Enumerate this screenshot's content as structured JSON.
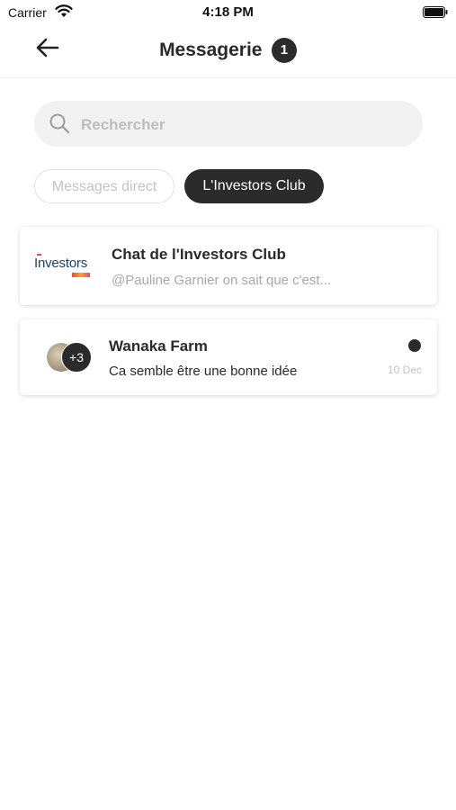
{
  "status_bar": {
    "carrier": "Carrier",
    "time": "4:18 PM"
  },
  "header": {
    "title": "Messagerie",
    "badge_count": "1",
    "back_icon": "arrow-left-icon"
  },
  "search": {
    "placeholder": "Rechercher",
    "value": "",
    "icon": "search-icon"
  },
  "tabs": [
    {
      "label": "Messages direct",
      "active": false
    },
    {
      "label": "L'Investors Club",
      "active": true
    }
  ],
  "conversations": [
    {
      "logo_text": "Investors",
      "name": "Chat de l'Investors Club",
      "preview": "@Pauline Garnier on sait que c'est...",
      "date": "",
      "unread": false
    },
    {
      "avatar_more": "+3",
      "name": "Wanaka Farm",
      "preview": "Ca semble être une bonne idée",
      "date": "10 Dec",
      "unread": true
    }
  ],
  "colors": {
    "accent_dark": "#2b2b2b",
    "search_bg": "#f1f1f1",
    "muted_text": "#a8a8a8",
    "logo_blue": "#1d3f73"
  }
}
